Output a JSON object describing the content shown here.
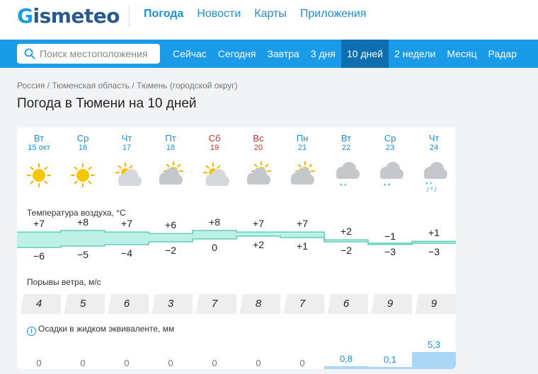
{
  "header": {
    "logo_g": "G",
    "logo_rest": "ismeteo",
    "nav": [
      "Погода",
      "Новости",
      "Карты",
      "Приложения"
    ]
  },
  "search": {
    "placeholder": "Поиск местоположения"
  },
  "subnav": [
    "Сейчас",
    "Сегодня",
    "Завтра",
    "3 дня",
    "10 дней",
    "2 недели",
    "Месяц",
    "Радар"
  ],
  "breadcrumb": "Россия / Тюменская область / Тюмень (городской округ)",
  "page_title": "Погода в Тюмени на 10 дней",
  "days": [
    {
      "day": "Вт",
      "date": "15 окт",
      "weekend": false,
      "icon": "sun-icon"
    },
    {
      "day": "Ср",
      "date": "16",
      "weekend": false,
      "icon": "sun-icon"
    },
    {
      "day": "Чт",
      "date": "17",
      "weekend": false,
      "icon": "partly-cloudy-icon"
    },
    {
      "day": "Пт",
      "date": "18",
      "weekend": false,
      "icon": "cloudy-sun-icon"
    },
    {
      "day": "Сб",
      "date": "19",
      "weekend": true,
      "icon": "partly-cloudy-icon"
    },
    {
      "day": "Вс",
      "date": "20",
      "weekend": true,
      "icon": "cloudy-sun-icon"
    },
    {
      "day": "Пн",
      "date": "21",
      "weekend": false,
      "icon": "cloudy-sun-icon"
    },
    {
      "day": "Вт",
      "date": "22",
      "weekend": false,
      "icon": "snow-cloud-icon"
    },
    {
      "day": "Ср",
      "date": "23",
      "weekend": false,
      "icon": "snow-cloud-icon"
    },
    {
      "day": "Чт",
      "date": "24",
      "weekend": false,
      "icon": "rain-snow-cloud-icon"
    }
  ],
  "temperature": {
    "label": "Температура воздуха, °C",
    "max": [
      "+7",
      "+8",
      "+7",
      "+6",
      "+8",
      "+7",
      "+7",
      "+2",
      "−1",
      "+1"
    ],
    "min": [
      "−6",
      "−5",
      "−4",
      "−2",
      "0",
      "+2",
      "+1",
      "−2",
      "−3",
      "−3"
    ],
    "max_values": [
      7,
      8,
      7,
      6,
      8,
      7,
      7,
      2,
      -1,
      1
    ],
    "min_values": [
      -6,
      -5,
      -4,
      -2,
      0,
      2,
      1,
      -2,
      -3,
      -3
    ]
  },
  "wind": {
    "label": "Порывы ветра, м/с",
    "values": [
      "4",
      "5",
      "6",
      "3",
      "7",
      "8",
      "7",
      "6",
      "9",
      "9"
    ]
  },
  "precip": {
    "label": "Осадки в жидком эквиваленте, мм",
    "values": [
      "0",
      "0",
      "0",
      "0",
      "0",
      "0",
      "0",
      "0,8",
      "0,1",
      "5,3"
    ],
    "amounts": [
      0,
      0,
      0,
      0,
      0,
      0,
      0,
      0.8,
      0.1,
      5.3
    ]
  },
  "colors": {
    "accent": "#1a9be8",
    "active_tab": "#0d6fb0",
    "weekend": "#c0392b",
    "temp_band": "#bdf0e6",
    "precip_bar": "#a9d7f5"
  }
}
